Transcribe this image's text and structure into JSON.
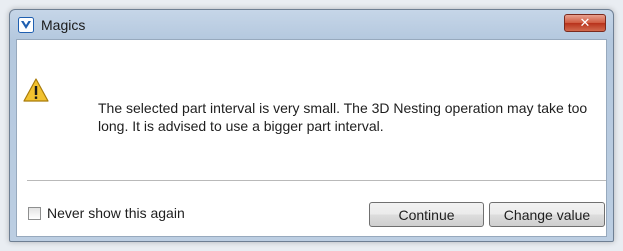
{
  "window": {
    "title": "Magics",
    "close_symbol": "✕",
    "app_icon": "magics-app-icon"
  },
  "dialog": {
    "icon": "warning-icon",
    "message": "The selected part interval is very small. The 3D Nesting operation may take too long. It is advised to use a bigger part interval."
  },
  "footer": {
    "checkbox_label": "Never show this again",
    "checkbox_checked": false,
    "continue_label": "Continue",
    "change_value_label": "Change value"
  },
  "colors": {
    "close_button": "#c9452b",
    "warning_fill": "#f2c230",
    "brand_blue": "#1f5fb0"
  }
}
